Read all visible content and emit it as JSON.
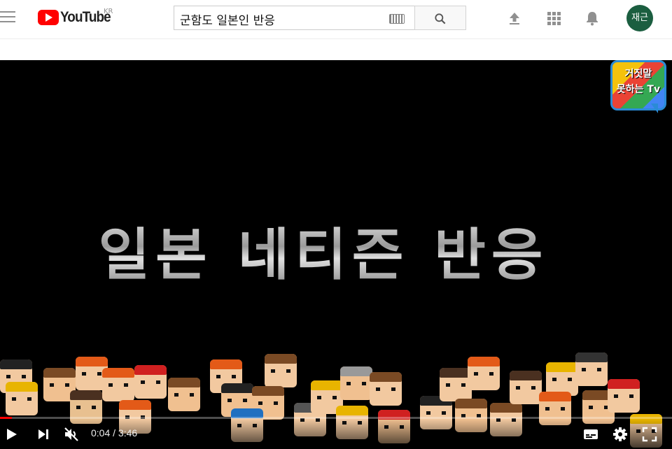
{
  "header": {
    "logo_text": "YouTube",
    "region": "KR",
    "search_value": "군함도 일본인 반응",
    "avatar_text": "재근"
  },
  "video": {
    "title_overlay": "일본 네티즌 반응",
    "channel_badge_line1": "거짓말",
    "channel_badge_line2": "못하는 Tv",
    "current_time": "0:04",
    "duration": "3:46",
    "time_display": "0:04 / 3:46",
    "progress_fraction": 0.018,
    "muted": true
  },
  "colors": {
    "brand_red": "#ff0000",
    "avatar_bg": "#1b5e40"
  },
  "icons": [
    "menu-icon",
    "keyboard-icon",
    "search-icon",
    "upload-icon",
    "apps-icon",
    "notifications-icon",
    "play-icon",
    "next-icon",
    "mute-icon",
    "subtitles-icon",
    "settings-icon",
    "fullscreen-icon"
  ]
}
